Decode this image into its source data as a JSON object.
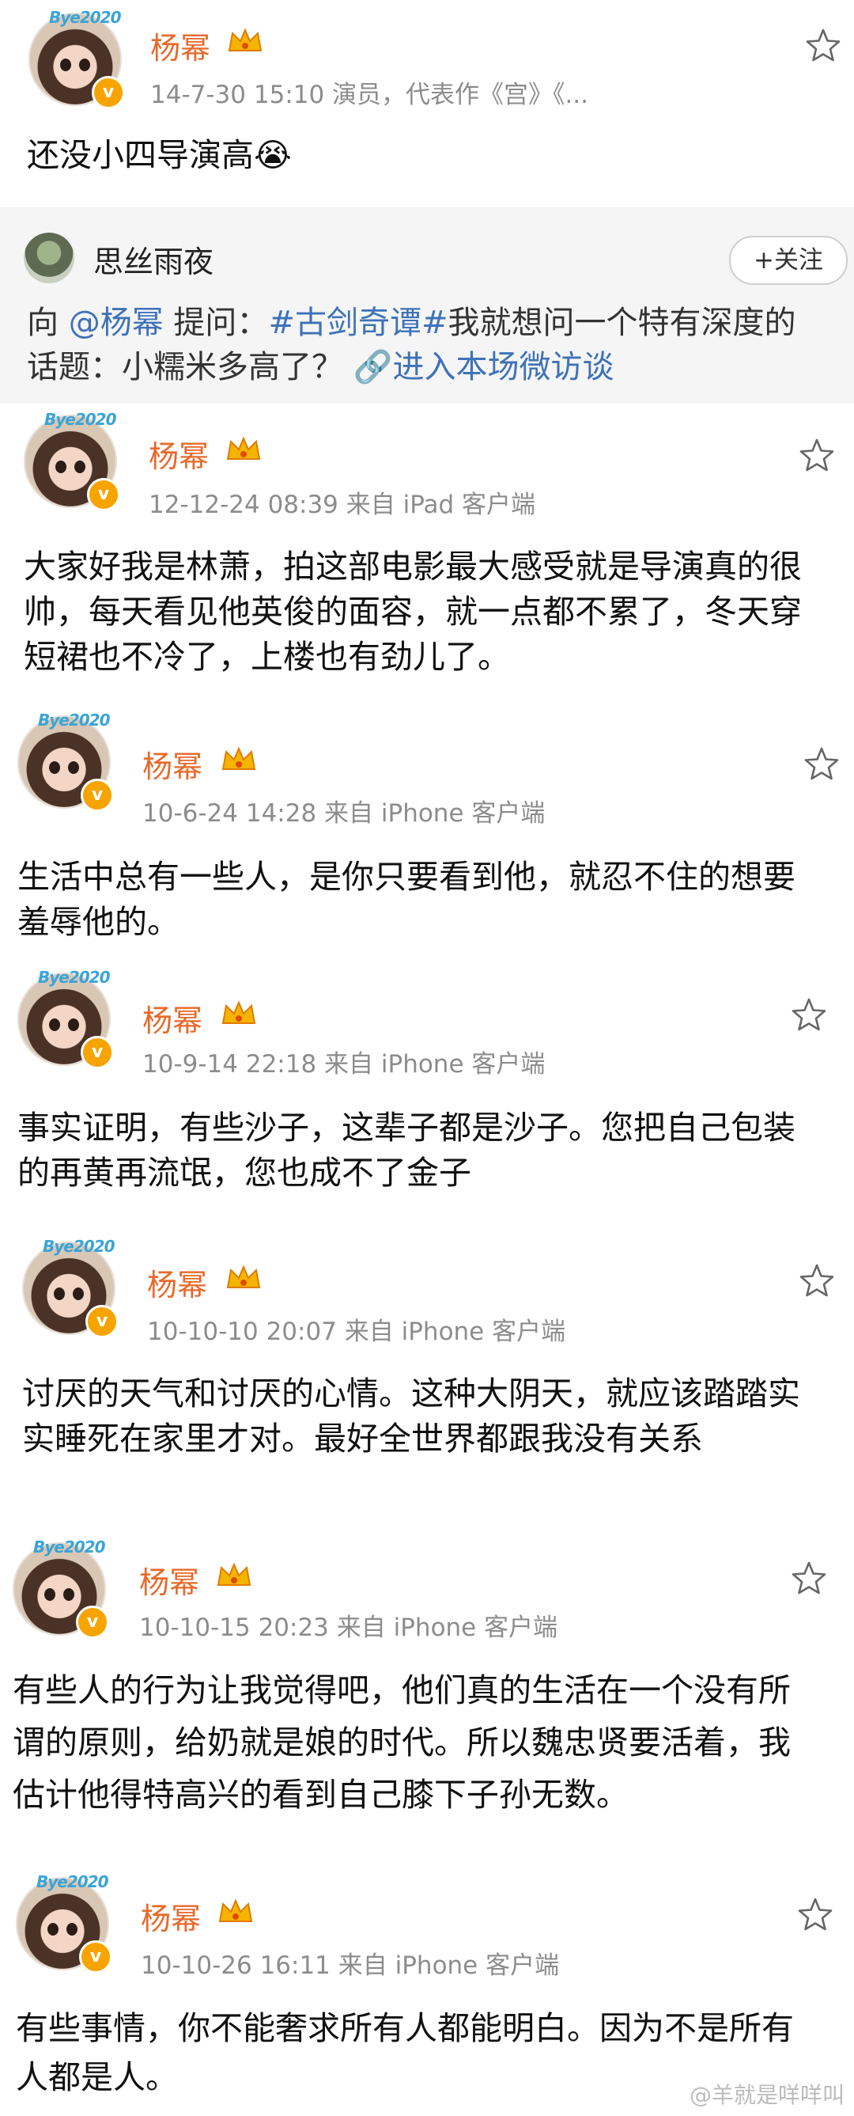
{
  "colors": {
    "username": "#e8692a",
    "meta": "#8c8c8c",
    "link": "#3e72b8",
    "vip": "#f7a400"
  },
  "posts": [
    {
      "username": "杨幂",
      "meta": "14-7-30 15:10  演员，代表作《宫》《...",
      "text": "还没小四导演高😭"
    },
    {
      "username": "杨幂",
      "meta": "12-12-24 08:39  来自 iPad 客户端",
      "text": "大家好我是林萧，拍这部电影最大感受就是导演真的很帅，每天看见他英俊的面容，就一点都不累了，冬天穿短裙也不冷了，上楼也有劲儿了。"
    },
    {
      "username": "杨幂",
      "meta": "10-6-24 14:28  来自 iPhone 客户端",
      "text": "生活中总有一些人，是你只要看到他，就忍不住的想要羞辱他的。"
    },
    {
      "username": "杨幂",
      "meta": "10-9-14 22:18  来自 iPhone 客户端",
      "text": "事实证明，有些沙子，这辈子都是沙子。您把自己包装的再黄再流氓，您也成不了金子"
    },
    {
      "username": "杨幂",
      "meta": "10-10-10 20:07  来自 iPhone 客户端",
      "text": "讨厌的天气和讨厌的心情。这种大阴天，就应该踏踏实实睡死在家里才对。最好全世界都跟我没有关系"
    },
    {
      "username": "杨幂",
      "meta": "10-10-15 20:23  来自 iPhone 客户端",
      "text": "有些人的行为让我觉得吧，他们真的生活在一个没有所谓的原则，给奶就是娘的时代。所以魏忠贤要活着，我估计他得特高兴的看到自己膝下子孙无数。"
    },
    {
      "username": "杨幂",
      "meta": "10-10-26 16:11  来自 iPhone 客户端",
      "text": "有些事情，你不能奢求所有人都能明白。因为不是所有人都是人。"
    }
  ],
  "qa": {
    "asker": "思丝雨夜",
    "follow_label": "+关注",
    "prefix": "向 ",
    "mention": "@杨幂",
    "ask": " 提问：",
    "topic": "#古剑奇谭#",
    "question": "我就想问一个特有深度的话题：小糯米多高了？ ",
    "enter_link": "🔗进入本场微访谈"
  },
  "watermark": "@羊就是咩咩叫"
}
